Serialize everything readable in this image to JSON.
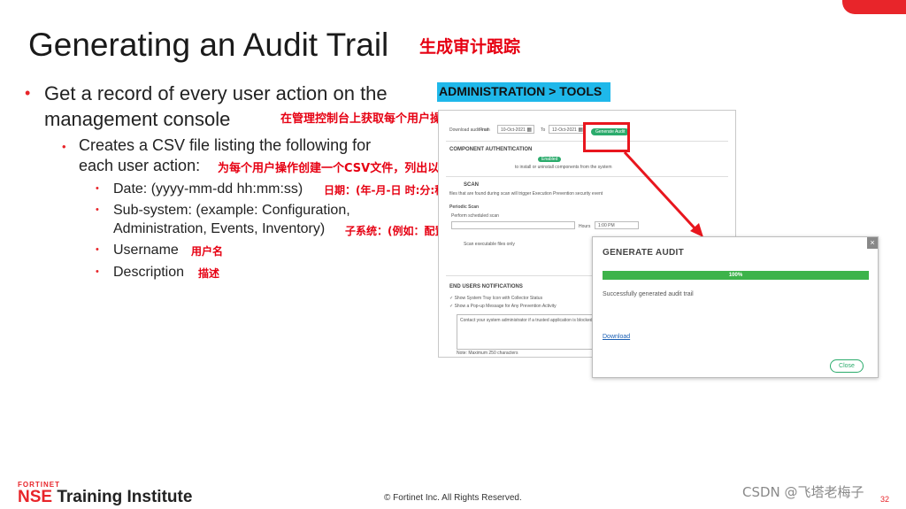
{
  "slide": {
    "title": "Generating an Audit Trail",
    "title_zh": "生成审计跟踪",
    "bullet1": "Get a record of every user action on the management console",
    "bullet1_zh": "在管理控制台上获取每个用户操作的记录",
    "bullet2": "Creates a CSV file listing the following for each user action:",
    "bullet2_zh": "为每个用户操作创建一个CSV文件，列出以下内容：",
    "sub_bullets": [
      {
        "text": "Date: (yyyy-mm-dd hh:mm:ss)",
        "zh": "日期：(年-月-日 时:分:秒)"
      },
      {
        "text_line1": "Sub-system: (example: Configuration,",
        "text_line2": "Administration, Events, Inventory)",
        "zh": "子系统：(例如：配置、管理、事件、目录)"
      },
      {
        "text": "Username",
        "zh": "用户名"
      },
      {
        "text": "Description",
        "zh": "描述"
      }
    ],
    "admin_label": "ADMINISTRATION > TOOLS"
  },
  "main_screenshot": {
    "download_audit_label": "Download audit trail",
    "from_label": "From",
    "from_date": "10-Oct-2021",
    "to_label": "To",
    "to_date": "12-Oct-2021",
    "generate_button": "Generate Audit",
    "component_auth_header": "COMPONENT AUTHENTICATION",
    "component_auth_toggle": "Enabled",
    "component_auth_desc": "to install or uninstall components from the system",
    "scan_header": "SCAN",
    "scan_desc": "files that are found during scan will trigger Execution Prevention security event",
    "periodic_scan": "Periodic Scan",
    "perform_scheduled": "Perform scheduled scan",
    "hours_label": "Hours",
    "hours_value": "1:00 PM",
    "scan_exec_only": "Scan executable files only",
    "end_users_header": "END USERS NOTIFICATIONS",
    "show_tray": "Show System Tray Icon with Collector Status",
    "show_popup": "Show a Pop-up Message for Any Prevention Activity",
    "textarea_text": "Contact your system administrator if a trusted application is blocked",
    "textarea_note": "Note: Maximum 250 characters"
  },
  "dialog": {
    "title": "GENERATE AUDIT",
    "progress_label": "100%",
    "progress_value": 100,
    "message": "Successfully generated audit trail",
    "download_link": "Download",
    "close_button": "Close",
    "close_icon": "×"
  },
  "footer": {
    "brand_top": "FORTINET",
    "brand_nse": "NSE",
    "brand_rest": " Training Institute",
    "copyright": "© Fortinet Inc. All Rights Reserved.",
    "watermark": "CSDN @飞塔老梅子",
    "page_number": "32"
  },
  "colors": {
    "accent_red": "#e8252a",
    "admin_blue": "#1fb8ea",
    "progress_green": "#3db34a",
    "button_green": "#2bab6c"
  }
}
